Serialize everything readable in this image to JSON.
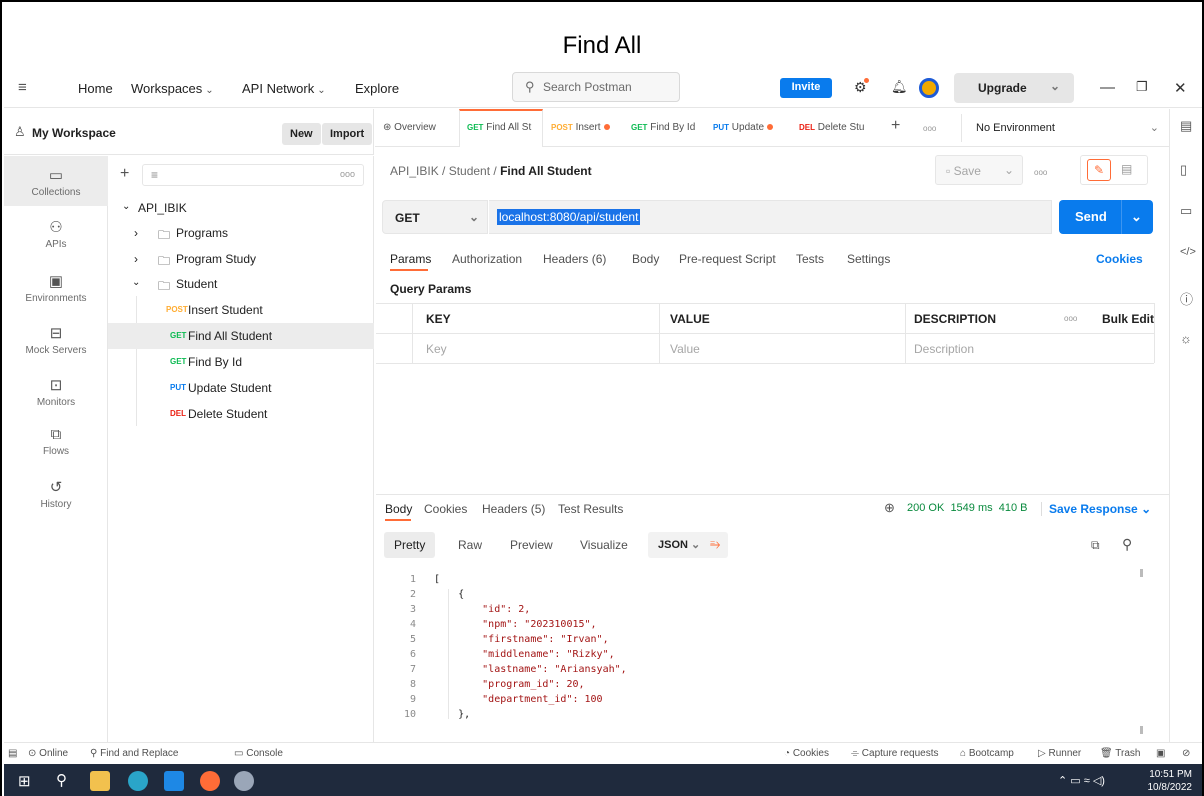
{
  "caption": "Find All",
  "topbar": {
    "home": "Home",
    "workspaces": "Workspaces",
    "api_network": "API Network",
    "explore": "Explore",
    "search_placeholder": "Search Postman",
    "invite": "Invite",
    "upgrade": "Upgrade"
  },
  "workspace": {
    "title": "My Workspace",
    "new": "New",
    "import": "Import"
  },
  "rail": [
    {
      "label": "Collections",
      "icon": "collections-icon"
    },
    {
      "label": "APIs",
      "icon": "apis-icon"
    },
    {
      "label": "Environments",
      "icon": "environments-icon"
    },
    {
      "label": "Mock Servers",
      "icon": "mock-servers-icon"
    },
    {
      "label": "Monitors",
      "icon": "monitors-icon"
    },
    {
      "label": "Flows",
      "icon": "flows-icon"
    },
    {
      "label": "History",
      "icon": "history-icon"
    }
  ],
  "tree": {
    "collection": "API_IBIK",
    "folders": [
      "Programs",
      "Program Study",
      "Student"
    ],
    "requests": [
      {
        "method": "POST",
        "name": "Insert Student"
      },
      {
        "method": "GET",
        "name": "Find All Student"
      },
      {
        "method": "GET",
        "name": "Find By Id"
      },
      {
        "method": "PUT",
        "name": "Update Student"
      },
      {
        "method": "DEL",
        "name": "Delete Student"
      }
    ]
  },
  "tabs": {
    "overview": "Overview",
    "items": [
      {
        "method": "GET",
        "name": "Find All St"
      },
      {
        "method": "POST",
        "name": "Insert"
      },
      {
        "method": "GET",
        "name": "Find By Id"
      },
      {
        "method": "PUT",
        "name": "Update"
      },
      {
        "method": "DEL",
        "name": "Delete Stu"
      }
    ],
    "environment": "No Environment"
  },
  "breadcrumb": {
    "path": "API_IBIK / Student / ",
    "current": "Find All Student",
    "save": "Save"
  },
  "request": {
    "method": "GET",
    "url": "localhost:8080/api/student",
    "send": "Send",
    "subtabs": [
      "Params",
      "Authorization",
      "Headers (6)",
      "Body",
      "Pre-request Script",
      "Tests",
      "Settings"
    ],
    "cookies": "Cookies",
    "query_params_title": "Query Params",
    "columns": [
      "KEY",
      "VALUE",
      "DESCRIPTION"
    ],
    "bulk_edit": "Bulk Edit",
    "placeholders": [
      "Key",
      "Value",
      "Description"
    ]
  },
  "response": {
    "tabs": [
      "Body",
      "Cookies",
      "Headers (5)",
      "Test Results"
    ],
    "status": "200 OK",
    "time": "1549 ms",
    "size": "410 B",
    "save_response": "Save Response",
    "modes": [
      "Pretty",
      "Raw",
      "Preview",
      "Visualize"
    ],
    "format": "JSON",
    "line_numbers": [
      "1",
      "2",
      "3",
      "4",
      "5",
      "6",
      "7",
      "8",
      "9",
      "10"
    ],
    "lines": [
      "[",
      "    {",
      "        \"id\": 2,",
      "        \"npm\": \"202310015\",",
      "        \"firstname\": \"Irvan\",",
      "        \"middlename\": \"Rizky\",",
      "        \"lastname\": \"Ariansyah\",",
      "        \"program_id\": 20,",
      "        \"department_id\": 100",
      "    },"
    ]
  },
  "footer": {
    "online": "Online",
    "find_replace": "Find and Replace",
    "console": "Console",
    "cookies": "Cookies",
    "capture": "Capture requests",
    "bootcamp": "Bootcamp",
    "runner": "Runner",
    "trash": "Trash"
  },
  "taskbar": {
    "time": "10:51 PM",
    "date": "10/8/2022"
  },
  "colors": {
    "accent": "#ff6c37",
    "send": "#097bed",
    "get": "#0cbb52",
    "post": "#ffad33",
    "put": "#097bed",
    "del": "#eb2013"
  }
}
